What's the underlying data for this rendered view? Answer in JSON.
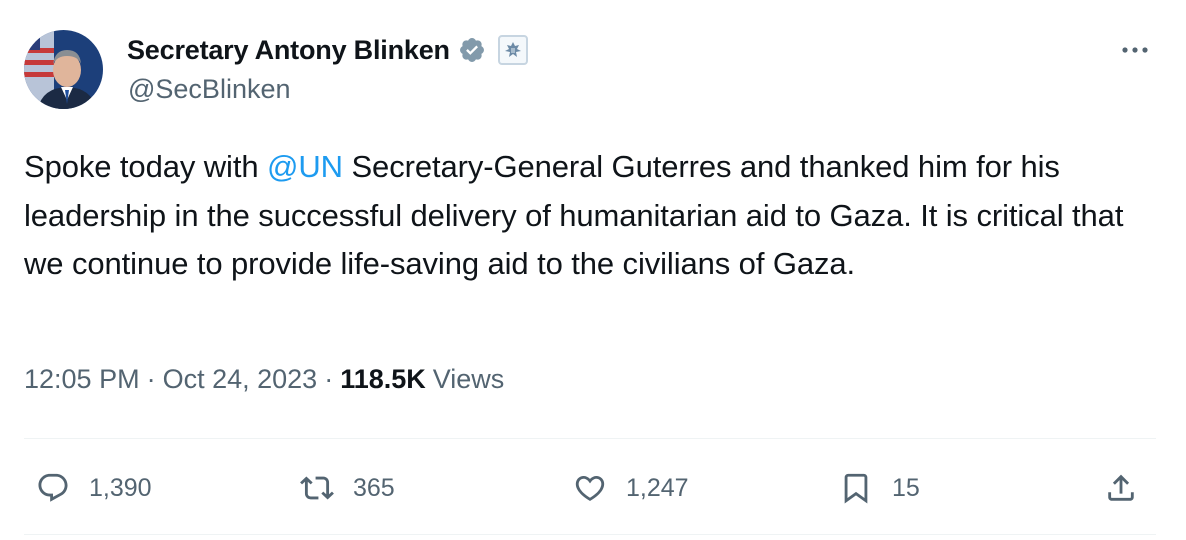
{
  "author": {
    "display_name": "Secretary Antony Blinken",
    "handle": "@SecBlinken",
    "verified_icon": "verified-badge-icon",
    "affiliation_icon": "us-state-department-seal-icon"
  },
  "tweet": {
    "text_before_mention": "Spoke today with ",
    "mention": "@UN",
    "text_after_mention": " Secretary-General Guterres and thanked him for his leadership in the successful delivery of humanitarian aid to Gaza. It is critical that we continue to provide life-saving aid to the civilians of Gaza."
  },
  "meta": {
    "time": "12:05 PM",
    "separator": "·",
    "date": "Oct 24, 2023",
    "views_count": "118.5K",
    "views_label": "Views"
  },
  "actions": {
    "replies": "1,390",
    "reposts": "365",
    "likes": "1,247",
    "bookmarks": "15"
  },
  "colors": {
    "text": "#0f1419",
    "secondary": "#536471",
    "link": "#1d9bf0",
    "divider": "#eff3f4"
  }
}
